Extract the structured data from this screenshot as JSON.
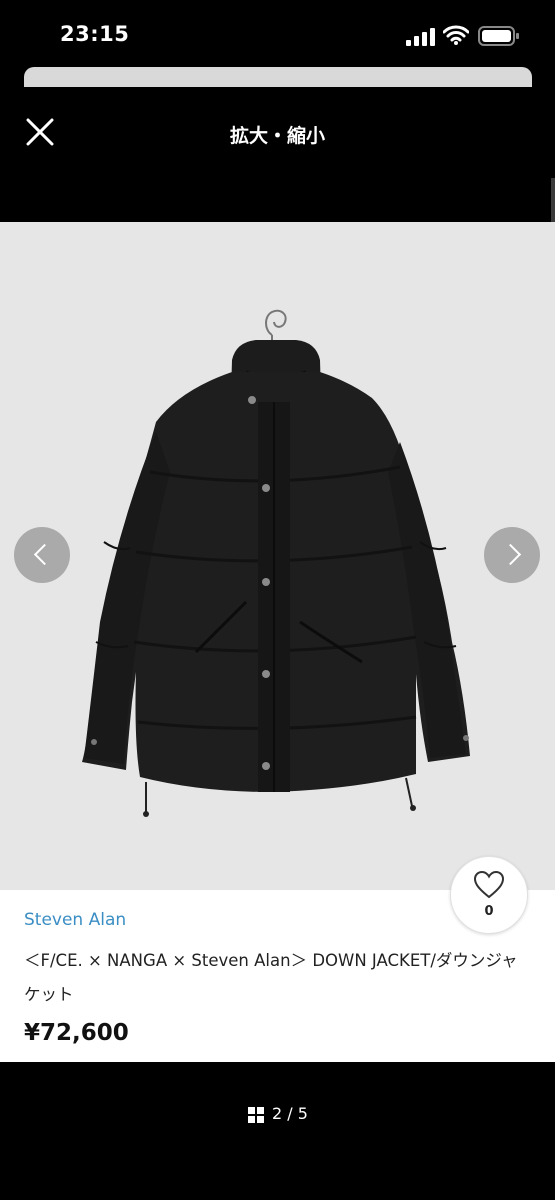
{
  "status_bar": {
    "time": "23:15"
  },
  "nav": {
    "title": "拡大・縮小"
  },
  "product": {
    "brand": "Steven Alan",
    "title": "＜F/CE. × NANGA × Steven Alan＞ DOWN JACKET/ダウンジャケット",
    "price": "¥72,600",
    "like_count": "0"
  },
  "pager": {
    "text": "2 / 5"
  },
  "icons": {
    "close": "close-icon",
    "prev": "chevron-left-icon",
    "next": "chevron-right-icon",
    "like": "heart-icon",
    "grid": "grid-icon"
  },
  "colors": {
    "brand_link": "#3b8ec4",
    "background": "#000000",
    "photo_bg": "#e5e5e5"
  }
}
